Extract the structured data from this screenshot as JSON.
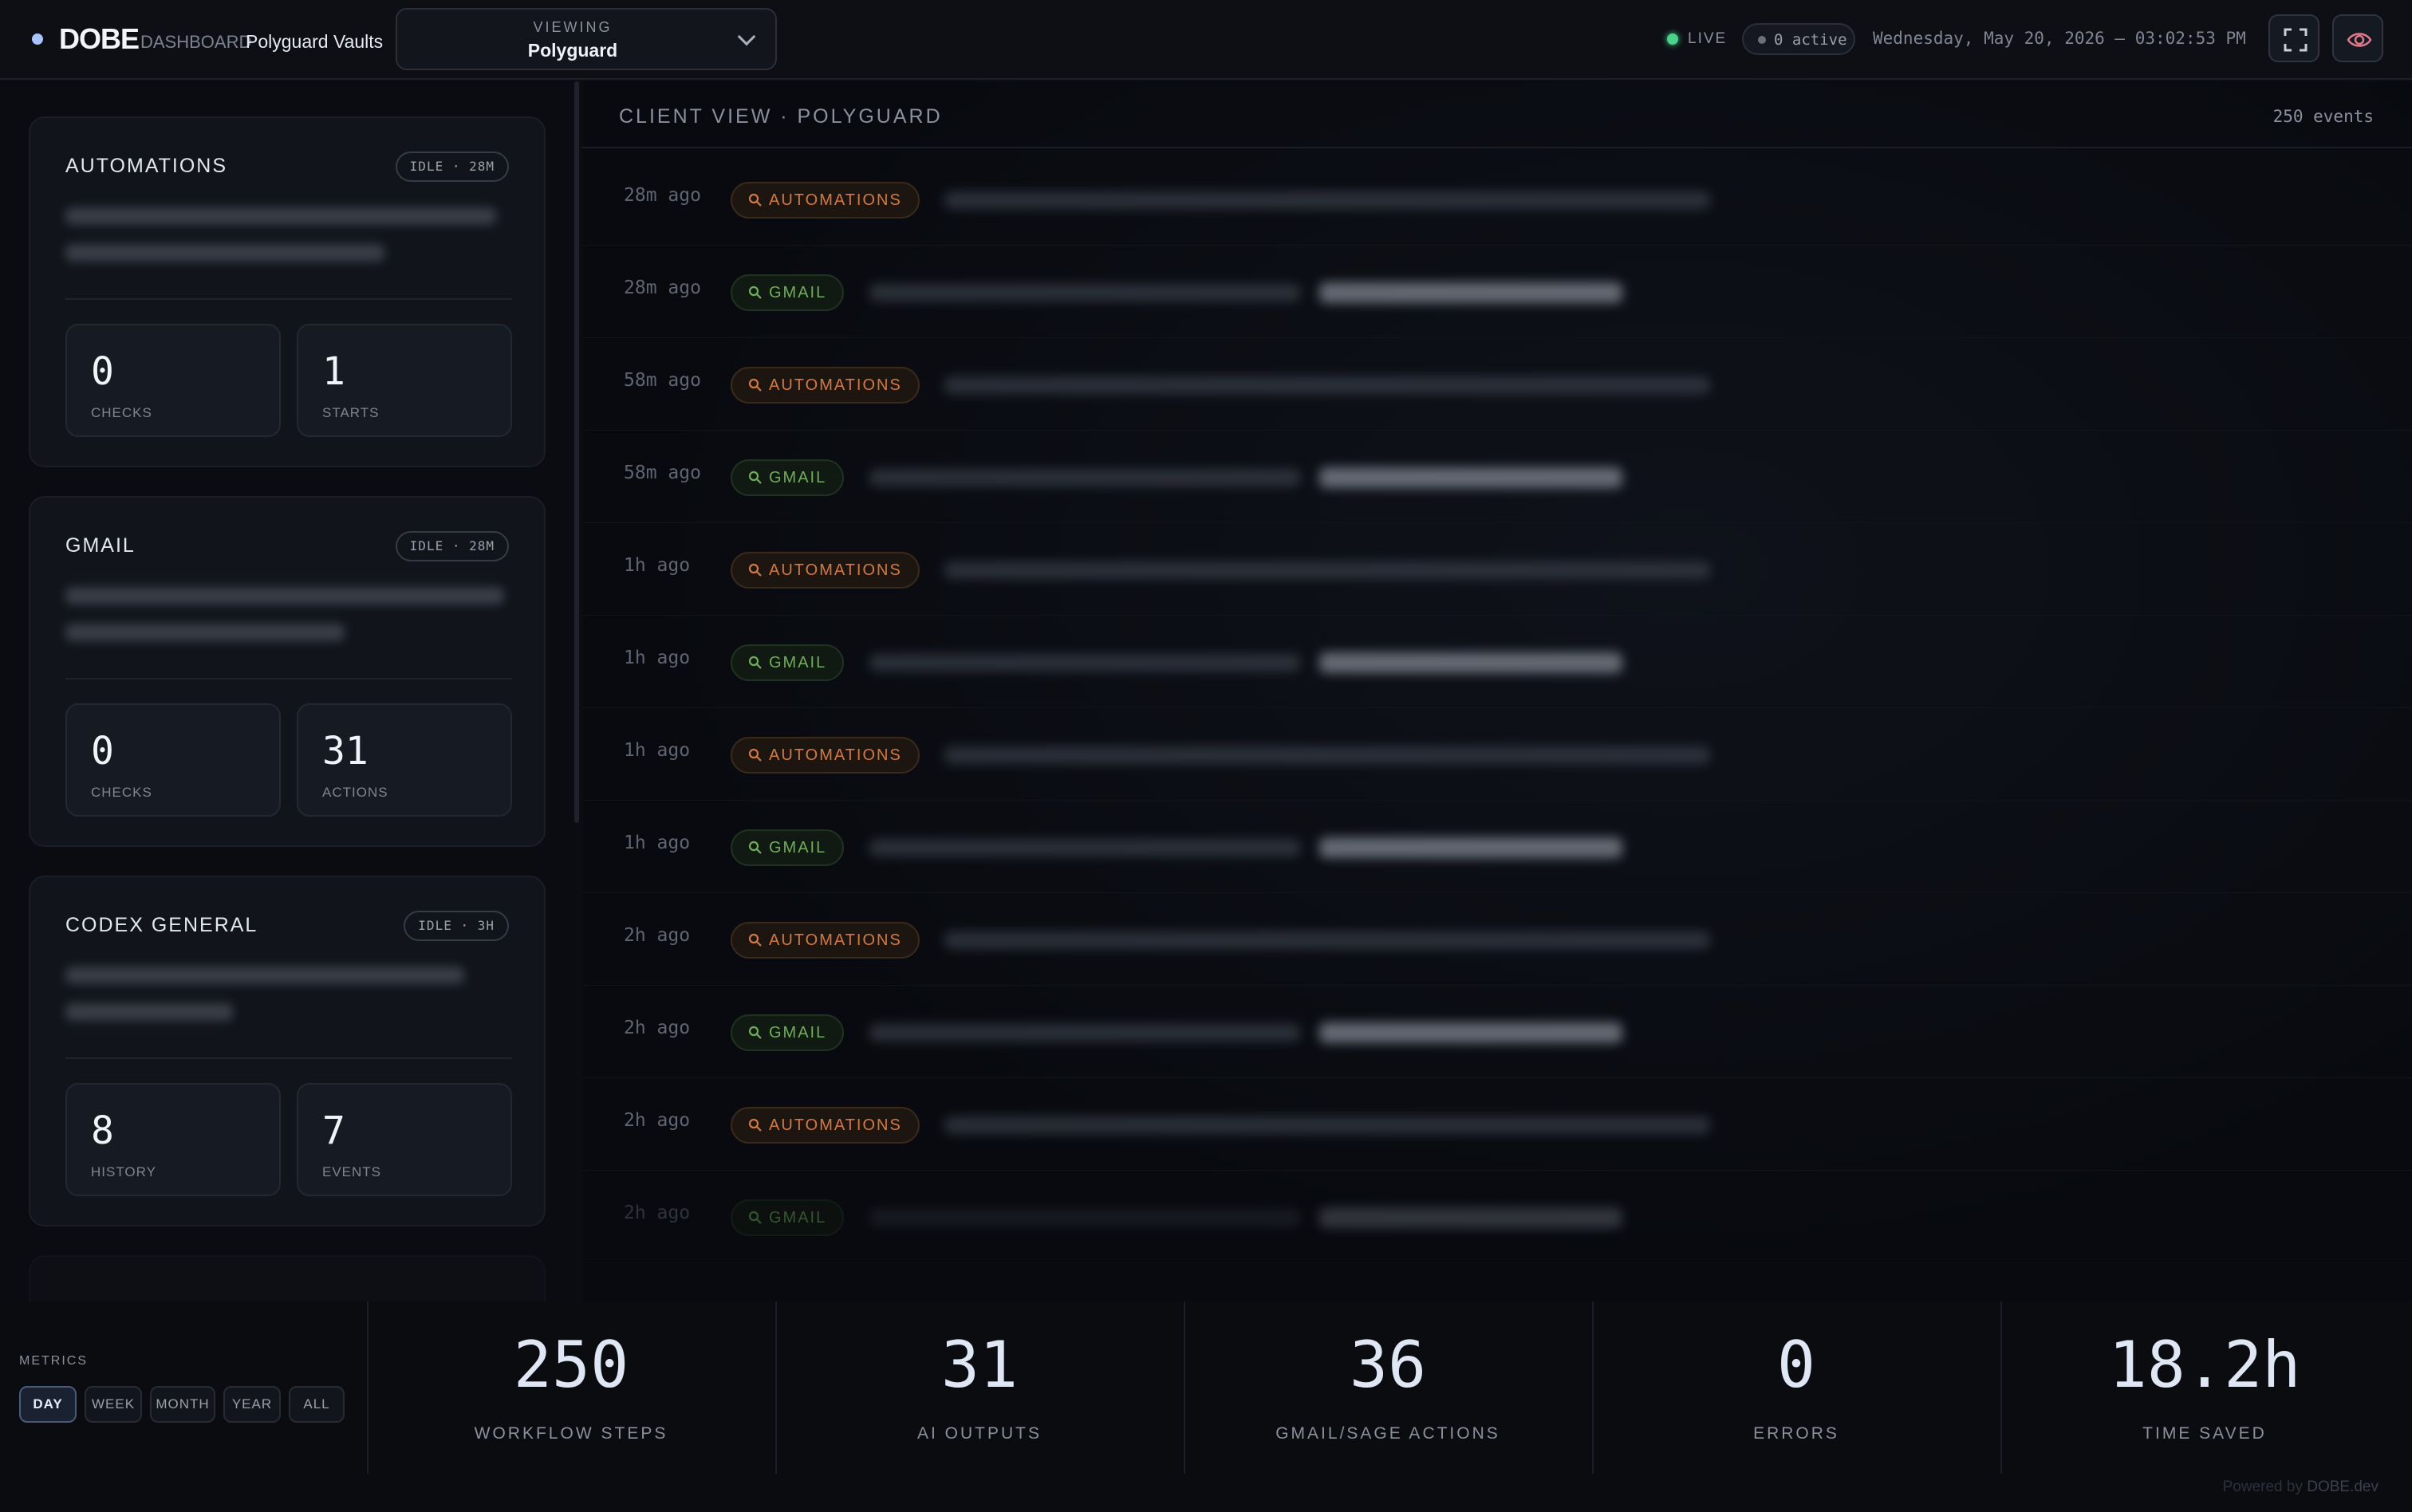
{
  "header": {
    "brand": "DOBE",
    "brand_sub": "DASHBOARD",
    "client_name": "Polyguard Vaults",
    "viewing_label": "VIEWING",
    "viewing_value": "Polyguard",
    "live_label": "LIVE",
    "active_label": "0 active",
    "datetime": "Wednesday, May 20, 2026 — 03:02:53 PM"
  },
  "sidebar": {
    "cards": [
      {
        "title": "AUTOMATIONS",
        "badge": "IDLE · 28M",
        "stats": [
          {
            "value": "0",
            "label": "CHECKS"
          },
          {
            "value": "1",
            "label": "STARTS"
          }
        ]
      },
      {
        "title": "GMAIL",
        "badge": "IDLE · 28M",
        "stats": [
          {
            "value": "0",
            "label": "CHECKS"
          },
          {
            "value": "31",
            "label": "ACTIONS"
          }
        ]
      },
      {
        "title": "CODEX GENERAL",
        "badge": "IDLE · 3H",
        "stats": [
          {
            "value": "8",
            "label": "HISTORY"
          },
          {
            "value": "7",
            "label": "EVENTS"
          }
        ]
      }
    ]
  },
  "feed": {
    "title": "CLIENT VIEW · POLYGUARD",
    "count": "250 events",
    "events": [
      {
        "time": "28m ago",
        "tag": "AUTOMATIONS"
      },
      {
        "time": "28m ago",
        "tag": "GMAIL"
      },
      {
        "time": "58m ago",
        "tag": "AUTOMATIONS"
      },
      {
        "time": "58m ago",
        "tag": "GMAIL"
      },
      {
        "time": "1h ago",
        "tag": "AUTOMATIONS"
      },
      {
        "time": "1h ago",
        "tag": "GMAIL"
      },
      {
        "time": "1h ago",
        "tag": "AUTOMATIONS"
      },
      {
        "time": "1h ago",
        "tag": "GMAIL"
      },
      {
        "time": "2h ago",
        "tag": "AUTOMATIONS"
      },
      {
        "time": "2h ago",
        "tag": "GMAIL"
      },
      {
        "time": "2h ago",
        "tag": "AUTOMATIONS"
      },
      {
        "time": "2h ago",
        "tag": "GMAIL"
      }
    ]
  },
  "metrics": {
    "label": "METRICS",
    "ranges": [
      "DAY",
      "WEEK",
      "MONTH",
      "YEAR",
      "ALL"
    ],
    "active_range": "DAY",
    "items": [
      {
        "value": "250",
        "label": "WORKFLOW STEPS"
      },
      {
        "value": "31",
        "label": "AI OUTPUTS"
      },
      {
        "value": "36",
        "label": "GMAIL/SAGE ACTIONS"
      },
      {
        "value": "0",
        "label": "ERRORS"
      },
      {
        "value": "18.2h",
        "label": "TIME SAVED"
      }
    ],
    "powered_prefix": "Powered by",
    "powered_brand": "DOBE.dev"
  },
  "colors": {
    "accent": "#a8c4ff",
    "live": "#4ad28a",
    "automations_tag": "#d47a3e",
    "gmail_tag": "#6fae58"
  },
  "icons": {
    "fullscreen": "fullscreen-icon",
    "eye": "eye-icon",
    "tag": "search-icon"
  }
}
